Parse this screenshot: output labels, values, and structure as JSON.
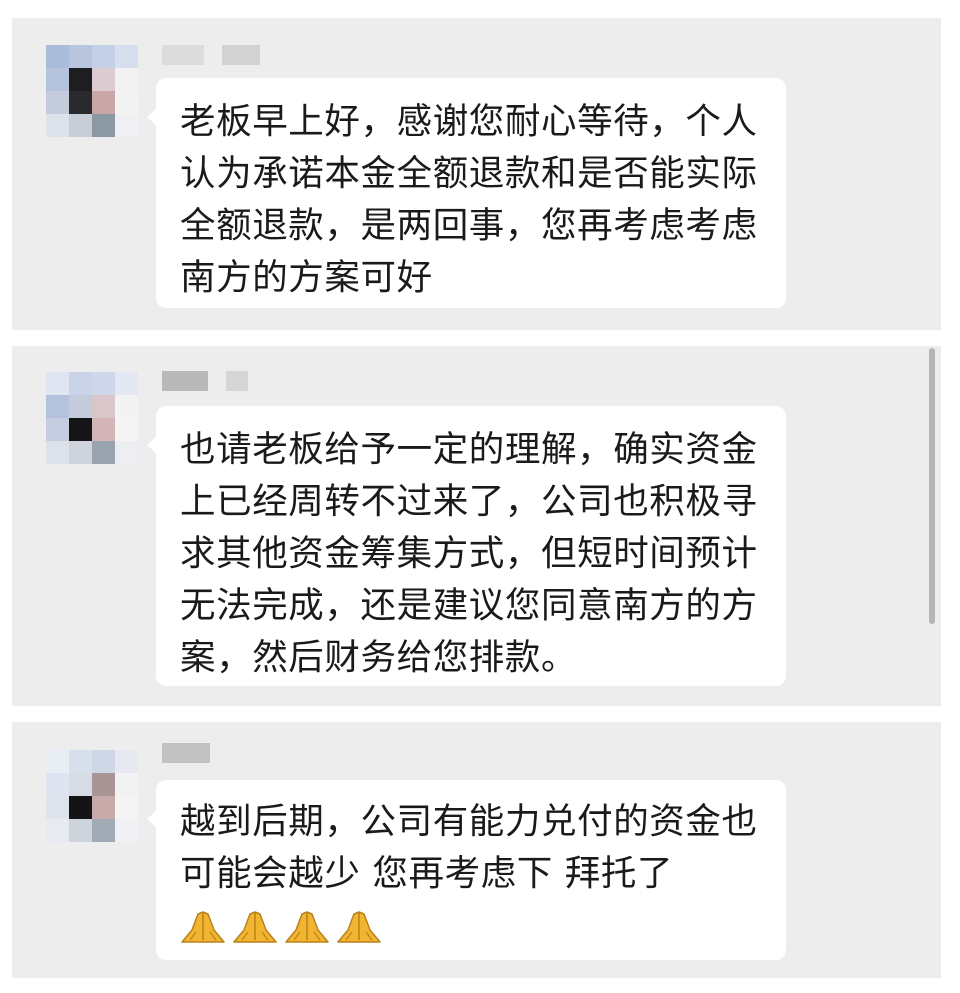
{
  "messages": [
    {
      "text": "老板早上好，感谢您耐心等待，个人认为承诺本金全额退款和是否能实际全额退款，是两回事，您再考虑考虑南方的方案可好"
    },
    {
      "text": "也请老板给予一定的理解，确实资金上已经周转不过来了，公司也积极寻求其他资金筹集方式，但短时间预计无法完成，还是建议您同意南方的方案，然后财务给您排款。"
    },
    {
      "text": "越到后期，公司有能力兑付的资金也可能会越少 您再考虑下 拜托了",
      "emoji": [
        "folded-hands-icon",
        "folded-hands-icon",
        "folded-hands-icon",
        "folded-hands-icon"
      ]
    }
  ],
  "colors": {
    "panel_bg": "#ededed",
    "bubble_bg": "#ffffff",
    "text": "#1a1a1a",
    "emoji": "#f2b531"
  }
}
